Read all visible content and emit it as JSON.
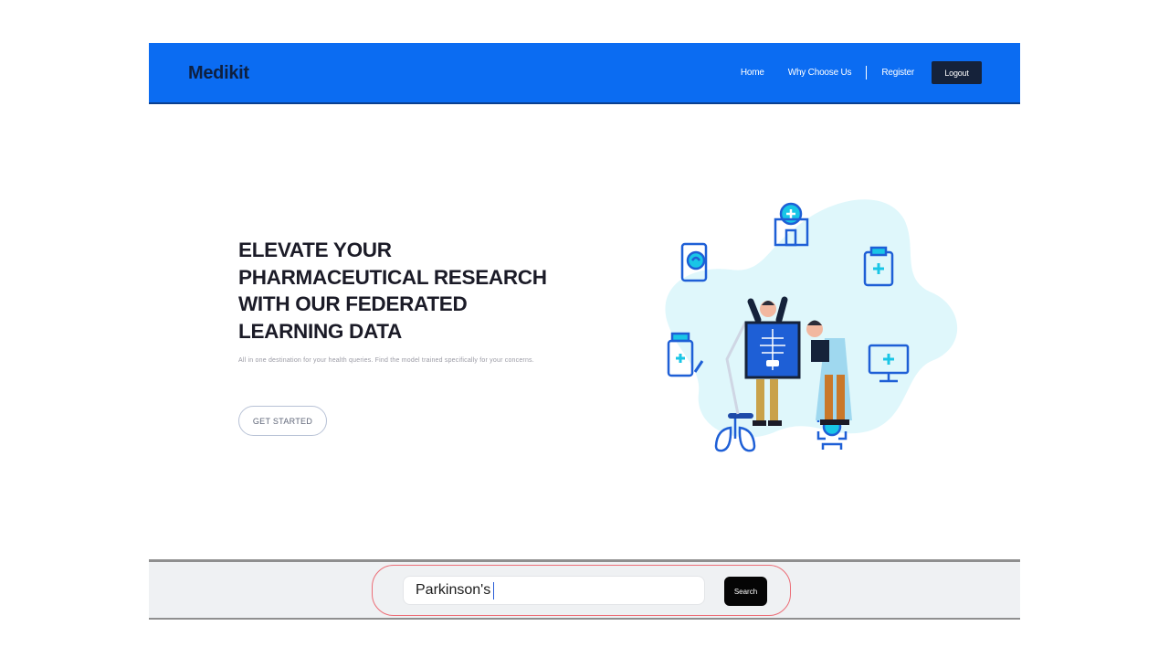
{
  "navbar": {
    "brand": "Medikit",
    "links": [
      "Home",
      "Why Choose Us",
      "Register"
    ],
    "logout_label": "Logout",
    "background": "#0b6cf2"
  },
  "hero": {
    "title_lines": [
      "ELEVATE YOUR",
      "PHARMACEUTICAL RESEARCH",
      "WITH OUR FEDERATED",
      "LEARNING DATA"
    ],
    "subtitle": "All in one destination for your health queries. Find the model trained specifically for your concerns.",
    "cta_label": "GET STARTED"
  },
  "illustration": {
    "icons": [
      "hospital-icon",
      "tablet-brain-icon",
      "clipboard-icon",
      "medicine-bottle-icon",
      "monitor-icon",
      "lungs-icon",
      "face-scan-icon",
      "xray-doctors-icon"
    ],
    "accent": "#1e88e5",
    "cyan": "#19c6e6"
  },
  "search": {
    "value": "Parkinson's",
    "button_label": "Search",
    "highlight_color": "#ec6d76"
  }
}
